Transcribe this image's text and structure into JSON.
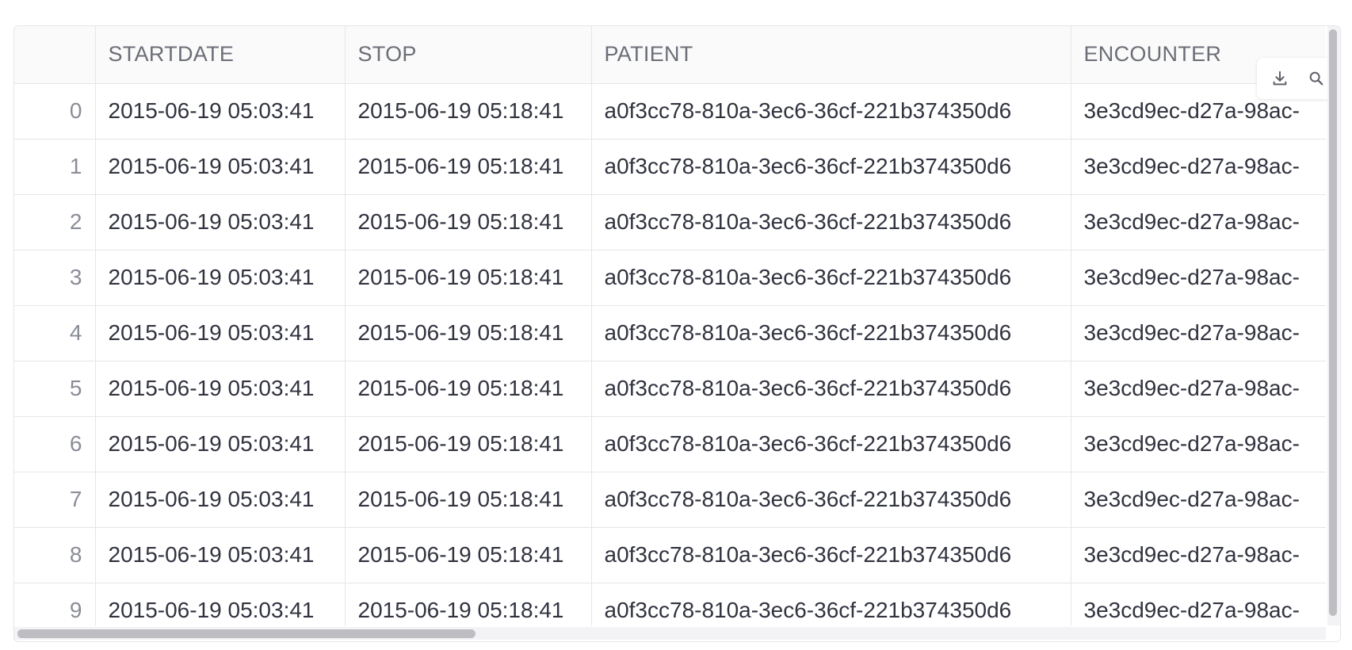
{
  "table": {
    "columns": [
      "",
      "STARTDATE",
      "STOP",
      "PATIENT",
      "ENCOUNTER"
    ],
    "rows": [
      {
        "index": "0",
        "startdate": "2015-06-19 05:03:41",
        "stop": "2015-06-19 05:18:41",
        "patient": "a0f3cc78-810a-3ec6-36cf-221b374350d6",
        "encounter": "3e3cd9ec-d27a-98ac-"
      },
      {
        "index": "1",
        "startdate": "2015-06-19 05:03:41",
        "stop": "2015-06-19 05:18:41",
        "patient": "a0f3cc78-810a-3ec6-36cf-221b374350d6",
        "encounter": "3e3cd9ec-d27a-98ac-"
      },
      {
        "index": "2",
        "startdate": "2015-06-19 05:03:41",
        "stop": "2015-06-19 05:18:41",
        "patient": "a0f3cc78-810a-3ec6-36cf-221b374350d6",
        "encounter": "3e3cd9ec-d27a-98ac-"
      },
      {
        "index": "3",
        "startdate": "2015-06-19 05:03:41",
        "stop": "2015-06-19 05:18:41",
        "patient": "a0f3cc78-810a-3ec6-36cf-221b374350d6",
        "encounter": "3e3cd9ec-d27a-98ac-"
      },
      {
        "index": "4",
        "startdate": "2015-06-19 05:03:41",
        "stop": "2015-06-19 05:18:41",
        "patient": "a0f3cc78-810a-3ec6-36cf-221b374350d6",
        "encounter": "3e3cd9ec-d27a-98ac-"
      },
      {
        "index": "5",
        "startdate": "2015-06-19 05:03:41",
        "stop": "2015-06-19 05:18:41",
        "patient": "a0f3cc78-810a-3ec6-36cf-221b374350d6",
        "encounter": "3e3cd9ec-d27a-98ac-"
      },
      {
        "index": "6",
        "startdate": "2015-06-19 05:03:41",
        "stop": "2015-06-19 05:18:41",
        "patient": "a0f3cc78-810a-3ec6-36cf-221b374350d6",
        "encounter": "3e3cd9ec-d27a-98ac-"
      },
      {
        "index": "7",
        "startdate": "2015-06-19 05:03:41",
        "stop": "2015-06-19 05:18:41",
        "patient": "a0f3cc78-810a-3ec6-36cf-221b374350d6",
        "encounter": "3e3cd9ec-d27a-98ac-"
      },
      {
        "index": "8",
        "startdate": "2015-06-19 05:03:41",
        "stop": "2015-06-19 05:18:41",
        "patient": "a0f3cc78-810a-3ec6-36cf-221b374350d6",
        "encounter": "3e3cd9ec-d27a-98ac-"
      },
      {
        "index": "9",
        "startdate": "2015-06-19 05:03:41",
        "stop": "2015-06-19 05:18:41",
        "patient": "a0f3cc78-810a-3ec6-36cf-221b374350d6",
        "encounter": "3e3cd9ec-d27a-98ac-"
      }
    ]
  },
  "toolbar": {
    "download_icon": "download-icon",
    "search_icon": "search-icon"
  },
  "colors": {
    "header_bg": "#fafafa",
    "border": "#e6e6ea",
    "text": "#31333f",
    "header_text": "#6b6e76",
    "scrollbar_thumb": "#bdbdc2"
  }
}
